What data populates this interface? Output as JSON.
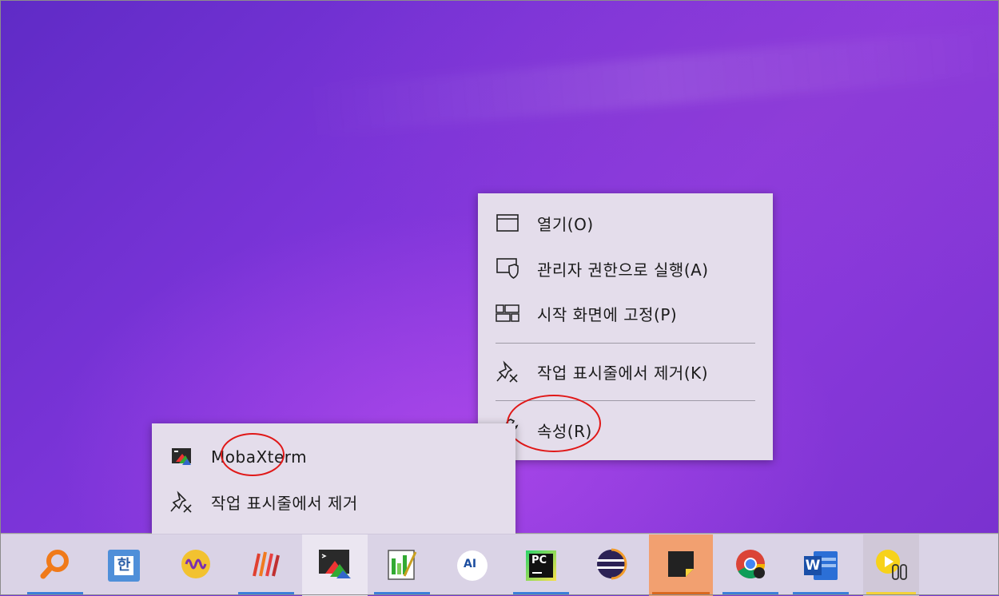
{
  "context_menu": {
    "items": [
      {
        "label": "열기(O)",
        "icon": "window-icon"
      },
      {
        "label": "관리자 권한으로 실행(A)",
        "icon": "shield-icon"
      },
      {
        "label": "시작 화면에 고정(P)",
        "icon": "pin-start-icon"
      },
      {
        "label": "작업 표시줄에서 제거(K)",
        "icon": "unpin-icon"
      },
      {
        "label": "속성(R)",
        "icon": "wrench-icon"
      }
    ]
  },
  "jump_list": {
    "app_label": "MobaXterm",
    "app_icon": "mobaxterm-icon",
    "unpin_label": "작업 표시줄에서 제거",
    "unpin_icon": "unpin-icon"
  },
  "taskbar": {
    "items": [
      {
        "icon": "search-magnifier-icon",
        "running": true
      },
      {
        "icon": "hancom-icon",
        "running": false
      },
      {
        "icon": "audio-wave-icon",
        "running": false
      },
      {
        "icon": "stripes-app-icon",
        "running": true
      },
      {
        "icon": "mobaxterm-icon",
        "running": false,
        "active": true
      },
      {
        "icon": "notepad-chart-icon",
        "running": true
      },
      {
        "icon": "ai-app-icon",
        "running": false
      },
      {
        "icon": "pycharm-icon",
        "running": true
      },
      {
        "icon": "eclipse-icon",
        "running": false
      },
      {
        "icon": "sticky-notes-icon",
        "running": true
      },
      {
        "icon": "chrome-icon",
        "running": true
      },
      {
        "icon": "word-icon",
        "running": true
      },
      {
        "icon": "media-player-icon",
        "running": true
      }
    ],
    "labels": {
      "pycharm": "PC",
      "word": "W",
      "ai": "AI",
      "hancom": "한"
    }
  },
  "colors": {
    "highlight": "#e01818",
    "running_indicator": "#3b7fd9"
  }
}
